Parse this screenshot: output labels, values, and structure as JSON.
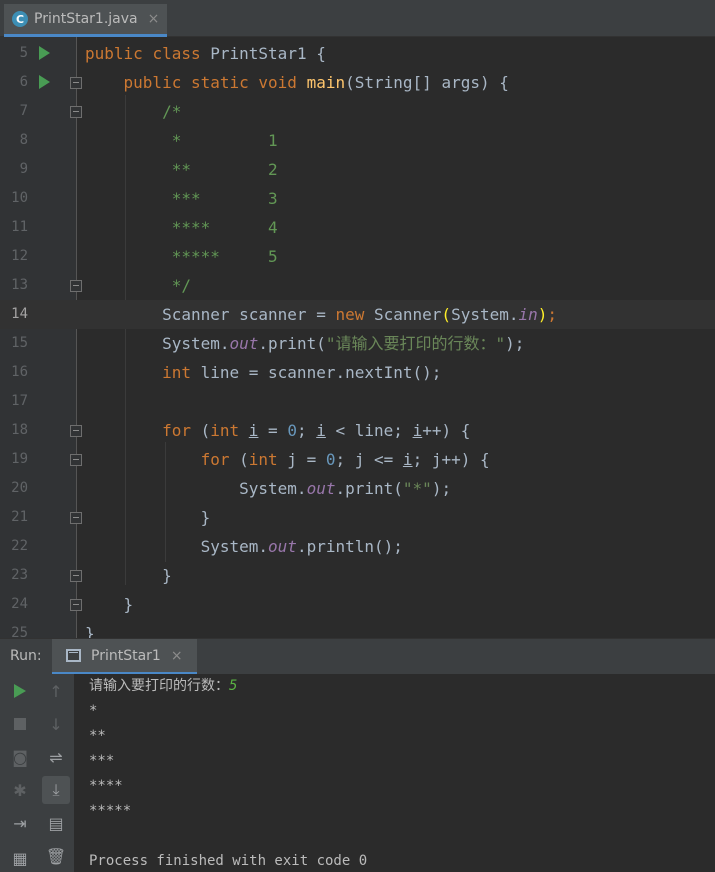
{
  "editor_tab": {
    "icon": "C",
    "filename": "PrintStar1.java",
    "close": "×"
  },
  "code_lines": [
    {
      "n": "5"
    },
    {
      "n": "6"
    },
    {
      "n": "7"
    },
    {
      "n": "8"
    },
    {
      "n": "9"
    },
    {
      "n": "10"
    },
    {
      "n": "11"
    },
    {
      "n": "12"
    },
    {
      "n": "13"
    },
    {
      "n": "14"
    },
    {
      "n": "15"
    },
    {
      "n": "16"
    },
    {
      "n": "17"
    },
    {
      "n": "18"
    },
    {
      "n": "19"
    },
    {
      "n": "20"
    },
    {
      "n": "21"
    },
    {
      "n": "22"
    },
    {
      "n": "23"
    },
    {
      "n": "24"
    },
    {
      "n": "25"
    }
  ],
  "code": {
    "l5": {
      "kw1": "public",
      "kw2": "class",
      "name": "PrintStar1",
      "rest": " {"
    },
    "l6": {
      "kw1": "public",
      "kw2": "static",
      "kw3": "void",
      "fn": "main",
      "rest": "(String[] args) {"
    },
    "l7": "/*",
    "l8": " *         1",
    "l9": " **        2",
    "l10": " ***       3",
    "l11": " ****      4",
    "l12": " *****     5",
    "l13": " */",
    "l14": {
      "a": "Scanner scanner = ",
      "kw": "new",
      "b": " Scanner",
      "p1": "(",
      "c": "System.",
      "fld": "in",
      "p2": ")",
      "d": ";"
    },
    "l15": {
      "a": "System.",
      "fld": "out",
      "b": ".print(",
      "str": "\"请输入要打印的行数：\"",
      "c": ");"
    },
    "l16": {
      "kw": "int",
      "a": " line = scanner.nextInt();"
    },
    "l18": {
      "kw1": "for",
      "a": " (",
      "kw2": "int",
      "v1": "i",
      "b": " = ",
      "num": "0",
      "c": "; ",
      "v2": "i",
      "d": " < line; ",
      "v3": "i",
      "e": "++) {"
    },
    "l19": {
      "kw1": "for",
      "a": " (",
      "kw2": "int",
      "b": " j = ",
      "num": "0",
      "c": "; j <= ",
      "v": "i",
      "d": "; j++) {"
    },
    "l20": {
      "a": "System.",
      "fld": "out",
      "b": ".print(",
      "str": "\"*\"",
      "c": ");"
    },
    "l21": "}",
    "l22": {
      "a": "System.",
      "fld": "out",
      "b": ".println();"
    },
    "l23": "}",
    "l24": "}",
    "l25": "}"
  },
  "run_panel": {
    "label": "Run:",
    "tab_name": "PrintStar1",
    "tab_close": "×",
    "prompt": "请输入要打印的行数：",
    "input_value": "5",
    "output_lines": [
      "*",
      "**",
      "***",
      "****",
      "*****"
    ],
    "exit_message": "Process finished with exit code 0"
  },
  "colors": {
    "background": "#2b2b2b",
    "keyword": "#cc7832",
    "function": "#ffc66d",
    "string": "#6a8759",
    "number": "#6897bb",
    "comment": "#629755",
    "field": "#9876aa",
    "run_green": "#499c54",
    "tab_accent": "#4a88c7"
  },
  "icons": {
    "run": "run-arrow-icon",
    "fold": "fold-marker-icon",
    "rerun": "rerun-icon",
    "stop": "stop-icon",
    "up": "up-arrow-icon",
    "down": "down-arrow-icon",
    "soft_wrap": "soft-wrap-icon",
    "scroll_end": "scroll-to-end-icon",
    "camera": "camera-icon",
    "print": "print-icon",
    "bug": "debug-icon",
    "exit": "exit-icon",
    "trash": "trash-icon",
    "layout": "layout-icon"
  }
}
